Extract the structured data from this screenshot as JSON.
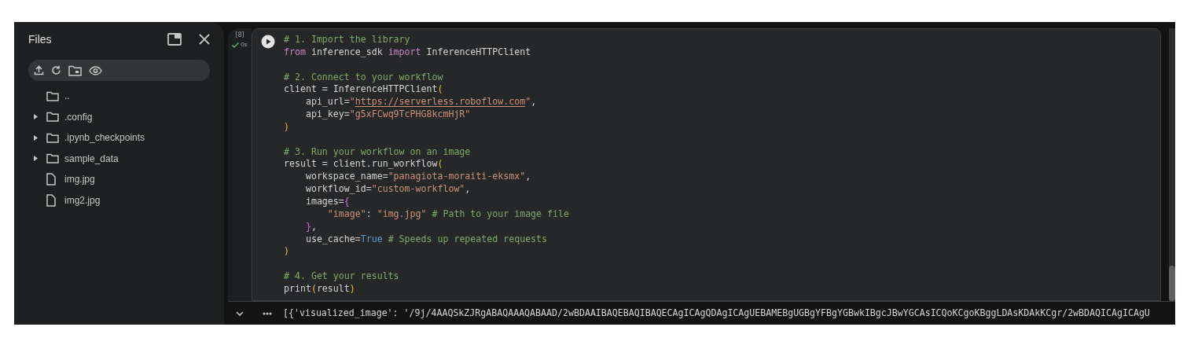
{
  "sidebar": {
    "title": "Files",
    "tree": [
      {
        "kind": "folder",
        "name": ".."
      },
      {
        "kind": "folder",
        "name": ".config",
        "expanded": false
      },
      {
        "kind": "folder",
        "name": ".ipynb_checkpoints",
        "expanded": false
      },
      {
        "kind": "folder",
        "name": "sample_data",
        "expanded": false
      },
      {
        "kind": "file",
        "name": "img.jpg"
      },
      {
        "kind": "file",
        "name": "img2.jpg"
      }
    ]
  },
  "cell": {
    "execution_count": "[8]",
    "run_time": "0s",
    "blocks": [
      {
        "lines": [
          {
            "tokens": [
              {
                "kind": "comment",
                "text": "# 1. Import the library"
              }
            ]
          },
          {
            "tokens": [
              {
                "kind": "keyword",
                "text": "from"
              },
              {
                "kind": "plain",
                "text": " inference_sdk "
              },
              {
                "kind": "keyword",
                "text": "import"
              },
              {
                "kind": "plain",
                "text": " InferenceHTTPClient"
              }
            ]
          }
        ]
      },
      {
        "lines": [
          {
            "tokens": [
              {
                "kind": "comment",
                "text": "# 2. Connect to your workflow"
              }
            ]
          },
          {
            "tokens": [
              {
                "kind": "plain",
                "text": "client = InferenceHTTPClient"
              },
              {
                "kind": "paren",
                "text": "("
              }
            ]
          },
          {
            "tokens": [
              {
                "kind": "plain",
                "text": "    api_url="
              },
              {
                "kind": "string",
                "text": "\""
              },
              {
                "kind": "link",
                "text": "https://serverless.roboflow.com"
              },
              {
                "kind": "string",
                "text": "\""
              },
              {
                "kind": "plain",
                "text": ","
              }
            ]
          },
          {
            "tokens": [
              {
                "kind": "plain",
                "text": "    api_key="
              },
              {
                "kind": "string",
                "text": "\"g5xFCwq9TcPHG8kcmHjR\""
              }
            ]
          },
          {
            "tokens": [
              {
                "kind": "paren",
                "text": ")"
              }
            ]
          }
        ]
      },
      {
        "lines": [
          {
            "tokens": [
              {
                "kind": "comment",
                "text": "# 3. Run your workflow on an image"
              }
            ]
          },
          {
            "tokens": [
              {
                "kind": "plain",
                "text": "result = client.run_workflow"
              },
              {
                "kind": "paren",
                "text": "("
              }
            ]
          },
          {
            "tokens": [
              {
                "kind": "plain",
                "text": "    workspace_name="
              },
              {
                "kind": "string",
                "text": "\"panagiota-moraiti-eksmx\""
              },
              {
                "kind": "plain",
                "text": ","
              }
            ]
          },
          {
            "tokens": [
              {
                "kind": "plain",
                "text": "    workflow_id="
              },
              {
                "kind": "string",
                "text": "\"custom-workflow\""
              },
              {
                "kind": "plain",
                "text": ","
              }
            ]
          },
          {
            "tokens": [
              {
                "kind": "plain",
                "text": "    images="
              },
              {
                "kind": "brace",
                "text": "{"
              }
            ]
          },
          {
            "tokens": [
              {
                "kind": "string",
                "text": "        \"image\""
              },
              {
                "kind": "plain",
                "text": ": "
              },
              {
                "kind": "string",
                "text": "\"img.jpg\""
              },
              {
                "kind": "comment",
                "text": " # Path to your image file"
              }
            ]
          },
          {
            "tokens": [
              {
                "kind": "brace",
                "text": "    }"
              },
              {
                "kind": "plain",
                "text": ","
              }
            ]
          },
          {
            "tokens": [
              {
                "kind": "plain",
                "text": "    use_cache="
              },
              {
                "kind": "bool",
                "text": "True"
              },
              {
                "kind": "comment",
                "text": " # Speeds up repeated requests"
              }
            ]
          },
          {
            "tokens": [
              {
                "kind": "paren",
                "text": ")"
              }
            ]
          }
        ]
      },
      {
        "lines": [
          {
            "tokens": [
              {
                "kind": "comment",
                "text": "# 4. Get your results"
              }
            ]
          },
          {
            "tokens": [
              {
                "kind": "plain",
                "text": "print"
              },
              {
                "kind": "paren",
                "text": "("
              },
              {
                "kind": "plain",
                "text": "result"
              },
              {
                "kind": "paren",
                "text": ")"
              }
            ]
          }
        ]
      }
    ],
    "output": "[{'visualized_image': '/9j/4AAQSkZJRgABAQAAAQABAAD/2wBDAAIBAQEBAQIBAQECAgICAgQDAgICAgUEBAMEBgUGBgYFBgYGBwkIBgcJBwYGCAsICQoKCgoKBggLDAsKDAkKCgr/2wBDAQICAgICAgU"
  }
}
